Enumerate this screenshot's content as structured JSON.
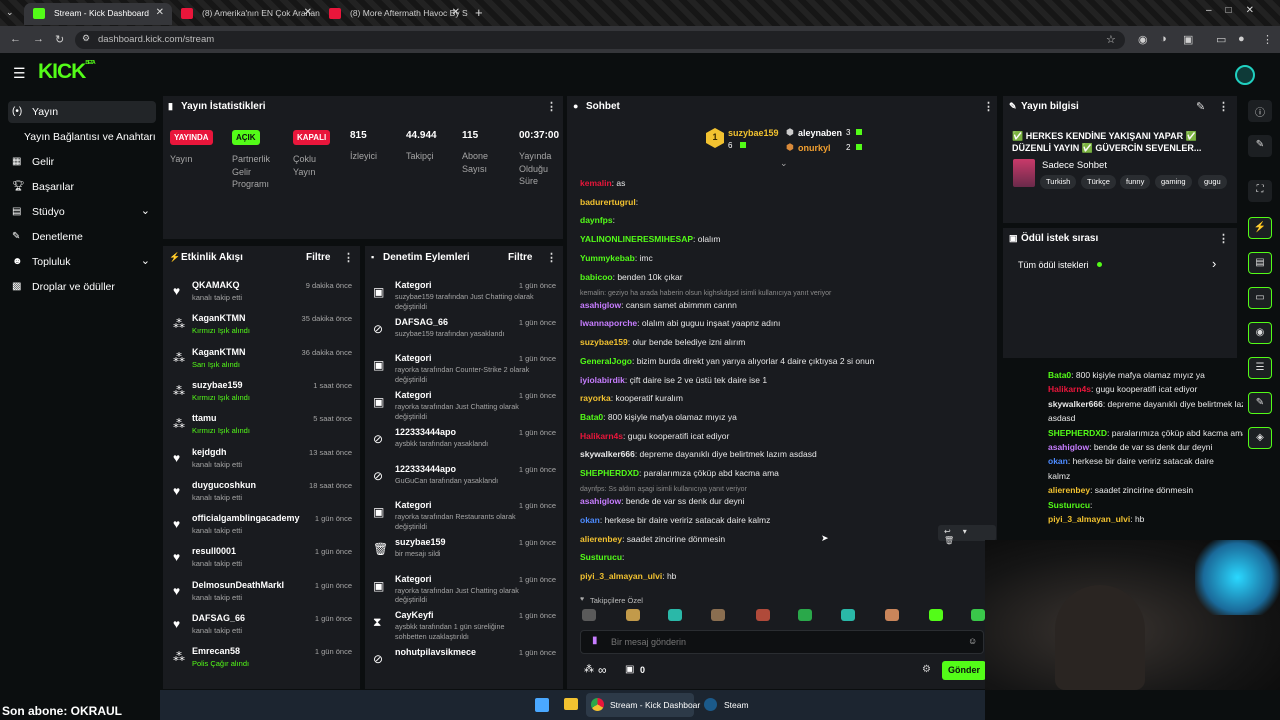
{
  "browser": {
    "tabs": [
      {
        "label": "Stream - Kick Dashboard",
        "active": true
      },
      {
        "label": "(8) Amerika'nın EN Çok Aranan...",
        "active": false
      },
      {
        "label": "(8) More Aftermath Havoc By S...",
        "active": false
      }
    ],
    "url": "dashboard.kick.com/stream"
  },
  "brand": {
    "logo": "KICK",
    "logo_sup": "BETA",
    "accent": "#53fc18"
  },
  "nav": {
    "items": [
      {
        "label": "Yayın",
        "icon": "broadcast-icon",
        "active": true
      },
      {
        "label": "Yayın Bağlantısı ve Anahtarı",
        "icon": "",
        "active": false
      },
      {
        "label": "Gelir",
        "icon": "revenue-icon",
        "active": false
      },
      {
        "label": "Başarılar",
        "icon": "trophy-icon",
        "active": false
      },
      {
        "label": "Stüdyo",
        "icon": "studio-icon",
        "active": false,
        "chevron": true
      },
      {
        "label": "Denetleme",
        "icon": "wrench-icon",
        "active": false
      },
      {
        "label": "Topluluk",
        "icon": "community-icon",
        "active": false,
        "chevron": true
      },
      {
        "label": "Droplar ve ödüller",
        "icon": "gift-icon",
        "active": false
      }
    ]
  },
  "stats": {
    "title": "Yayın İstatistikleri",
    "badges": [
      {
        "badge": "YAYINDA",
        "label": "Yayın",
        "color": "#e9163b"
      },
      {
        "badge": "AÇIK",
        "label": "Partnerlik Gelir Programı",
        "color": "#53fc18"
      },
      {
        "badge": "KAPALI",
        "label": "Çoklu Yayın",
        "color": "#e9163b"
      }
    ],
    "numbers": [
      {
        "value": "815",
        "label": "İzleyici"
      },
      {
        "value": "44.944",
        "label": "Takipçi"
      },
      {
        "value": "115",
        "label": "Abone Sayısı"
      },
      {
        "value": "00:37:00",
        "label": "Yayında Olduğu Süre"
      }
    ]
  },
  "activity": {
    "title": "Etkinlik Akışı",
    "filter": "Filtre",
    "items": [
      {
        "name": "QKAMAKQ",
        "sub": "kanalı takip etti",
        "time": "9 dakika önce",
        "icon": "heart-icon"
      },
      {
        "name": "KaganKTMN",
        "sub": "Kırmızı Işık alındı",
        "time": "35 dakika önce",
        "icon": "reward-icon"
      },
      {
        "name": "KaganKTMN",
        "sub": "Sarı Işık alındı",
        "time": "36 dakika önce",
        "icon": "reward-icon"
      },
      {
        "name": "suzybae159",
        "sub": "Kırmızı Işık alındı",
        "time": "1 saat önce",
        "icon": "reward-icon"
      },
      {
        "name": "ttamu",
        "sub": "Kırmızı Işık alındı",
        "time": "5 saat önce",
        "icon": "reward-icon"
      },
      {
        "name": "kejdgdh",
        "sub": "kanalı takip etti",
        "time": "13 saat önce",
        "icon": "heart-icon"
      },
      {
        "name": "duygucoshkun",
        "sub": "kanalı takip etti",
        "time": "18 saat önce",
        "icon": "heart-icon"
      },
      {
        "name": "officialgamblingacademy",
        "sub": "kanalı takip etti",
        "time": "1 gün önce",
        "icon": "heart-icon"
      },
      {
        "name": "resull0001",
        "sub": "kanalı takip etti",
        "time": "1 gün önce",
        "icon": "heart-icon"
      },
      {
        "name": "DelmosunDeathMarkI",
        "sub": "kanalı takip etti",
        "time": "1 gün önce",
        "icon": "heart-icon"
      },
      {
        "name": "DAFSAG_66",
        "sub": "kanalı takip etti",
        "time": "1 gün önce",
        "icon": "heart-icon"
      },
      {
        "name": "Emrecan58",
        "sub": "Polis Çağır alındı",
        "time": "1 gün önce",
        "icon": "reward-icon"
      }
    ]
  },
  "moderation": {
    "title": "Denetim Eylemleri",
    "filter": "Filtre",
    "items": [
      {
        "name": "Kategori",
        "sub": "suzybae159 tarafından Just Chatting olarak değiştirildi",
        "time": "1 gün önce",
        "icon": "category-icon"
      },
      {
        "name": "DAFSAG_66",
        "sub": "suzybae159 tarafından yasaklandı",
        "time": "1 gün önce",
        "icon": "ban-icon"
      },
      {
        "name": "Kategori",
        "sub": "rayorka tarafından Counter-Strike 2 olarak değiştirildi",
        "time": "1 gün önce",
        "icon": "category-icon"
      },
      {
        "name": "Kategori",
        "sub": "rayorka tarafından Just Chatting olarak değiştirildi",
        "time": "1 gün önce",
        "icon": "category-icon"
      },
      {
        "name": "122333444apo",
        "sub": "aysbkk tarafından yasaklandı",
        "time": "1 gün önce",
        "icon": "ban-icon"
      },
      {
        "name": "122333444apo",
        "sub": "GuGuCan tarafından yasaklandı",
        "time": "1 gün önce",
        "icon": "ban-icon"
      },
      {
        "name": "Kategori",
        "sub": "rayorka tarafından Restaurants olarak değiştirildi",
        "time": "1 gün önce",
        "icon": "category-icon"
      },
      {
        "name": "suzybae159",
        "sub": "bir mesajı sildi",
        "time": "1 gün önce",
        "icon": "trash-icon"
      },
      {
        "name": "Kategori",
        "sub": "rayorka tarafından Just Chatting olarak değiştirildi",
        "time": "1 gün önce",
        "icon": "category-icon"
      },
      {
        "name": "CayKeyfi",
        "sub": "aysbkk tarafından 1 gün süreliğine sohbetten uzaklaştırıldı",
        "time": "1 gün önce",
        "icon": "timeout-icon"
      },
      {
        "name": "nohutpilavsikmece",
        "sub": "",
        "time": "1 gün önce",
        "icon": "ban-icon"
      }
    ]
  },
  "chat": {
    "title": "Sohbet",
    "leaders": [
      {
        "name": "suzybae159",
        "count": "6"
      },
      {
        "name": "aleynaben",
        "count": "3"
      },
      {
        "name": "onurkyl",
        "count": "2"
      }
    ],
    "messages": [
      {
        "user": "kemalin",
        "color": "#e9163b",
        "text": ": as"
      },
      {
        "user": "badurertugrul",
        "color": "#f2c230",
        "text": ":"
      },
      {
        "user": "daynfps",
        "color": "#53fc18",
        "text": ":"
      },
      {
        "user": "YALINONLINERESMIHESAP",
        "color": "#53fc18",
        "text": ": olalım"
      },
      {
        "user": "Yummykebab",
        "color": "#53fc18",
        "text": ": imc"
      },
      {
        "user": "babicoo",
        "color": "#53fc18",
        "text": ": benden 10k çıkar"
      },
      {
        "reply": "kemalin: geziyo ha arada haberin olsun kighskdgsd isimli kullanıcıya yanıt veriyor"
      },
      {
        "user": "asahiglow",
        "color": "#c77dff",
        "text": ": cansın samet abimmm cannn"
      },
      {
        "user": "lwannaporche",
        "color": "#c77dff",
        "text": ": olalım abi guguu inşaat yaapnz adını"
      },
      {
        "user": "suzybae159",
        "color": "#f2c230",
        "text": ": olur bende belediye izni alırım"
      },
      {
        "user": "GeneralJogo",
        "color": "#53fc18",
        "text": ": bizim burda direkt yan yarıya alıyorlar 4 daire çıktıysa 2 si onun"
      },
      {
        "user": "iyiolabirdik",
        "color": "#c77dff",
        "text": ": çift daire ise 2 ve üstü tek daire ise 1"
      },
      {
        "user": "rayorka",
        "color": "#f2c230",
        "text": ": kooperatif kuralım"
      },
      {
        "user": "Bata0",
        "color": "#53fc18",
        "text": ": 800 kişiyle mafya olamaz mıyız ya"
      },
      {
        "user": "Halikarn4s",
        "color": "#e9163b",
        "text": ": gugu kooperatifi icat ediyor"
      },
      {
        "user": "skywalker666",
        "color": "#e8e8e8",
        "text": ": depreme dayanıklı diye belirtmek lazım asdasd"
      },
      {
        "user": "SHEPHERDXD",
        "color": "#53fc18",
        "text": ": paralarımıza çöküp abd kacma ama"
      },
      {
        "reply": "daynfps: Ss aldım aşagi isimli kullanıcıya yanıt veriyor"
      },
      {
        "user": "asahiglow",
        "color": "#c77dff",
        "text": ": bende de var ss denk dur deyni"
      },
      {
        "user": "okan",
        "color": "#4d8bff",
        "text": ": herkese bir daire veririz satacak daire kalmz"
      },
      {
        "user": "alierenbey",
        "color": "#f2c230",
        "text": ": saadet zincirine dönmesin"
      },
      {
        "user": "Susturucu",
        "color": "#53fc18",
        "text": ":"
      },
      {
        "user": "piyi_3_almayan_ulvi",
        "color": "#f2c230",
        "text": ": hb"
      }
    ],
    "followers_only": "Takipçilere Özel",
    "input_placeholder": "Bir mesaj gönderin",
    "infinity": "∞",
    "zero": "0",
    "send": "Gönder"
  },
  "stream_info": {
    "title": "Yayın bilgisi",
    "stream_title": "✅ HERKES KENDİNE YAKIŞANI YAPAR ✅ DÜZENLİ YAYIN ✅ GÜVERCİN SEVENLER...",
    "category": "Sadece Sohbet",
    "tags": [
      "Turkish",
      "Türkçe",
      "funny",
      "gaming",
      "gugu"
    ]
  },
  "rewards": {
    "title": "Ödül istek sırası",
    "all": "Tüm ödül istekleri"
  },
  "side_chat": [
    {
      "user": "Bata0",
      "color": "#53fc18",
      "text": ": 800 kişiyle mafya olamaz mıyız ya"
    },
    {
      "user": "Halikarn4s",
      "color": "#e9163b",
      "text": ": gugu kooperatifi icat ediyor"
    },
    {
      "user": "skywalker666",
      "color": "#e8e8e8",
      "text": ": depreme dayanıklı diye belirtmek lazım"
    },
    {
      "user": "",
      "color": "#e8e8e8",
      "text": "asdasd"
    },
    {
      "user": "SHEPHERDXD",
      "color": "#53fc18",
      "text": ": paralarımıza çöküp abd kacma ama"
    },
    {
      "user": "asahiglow",
      "color": "#c77dff",
      "text": ": bende de var ss denk dur deyni"
    },
    {
      "user": "okan",
      "color": "#4d8bff",
      "text": ": herkese bir daire veririz satacak daire"
    },
    {
      "user": "",
      "color": "#e8e8e8",
      "text": "kalmz"
    },
    {
      "user": "alierenbey",
      "color": "#f2c230",
      "text": ": saadet zincirine dönmesin"
    },
    {
      "user": "Susturucu",
      "color": "#53fc18",
      "text": ":"
    },
    {
      "user": "piyi_3_almayan_ulvi",
      "color": "#f2c230",
      "text": ": hb"
    }
  ],
  "overlay": {
    "last_sub": "Son abone: OKRAUL"
  },
  "taskbar": {
    "items": [
      {
        "label": "Stream - Kick Dashboar"
      },
      {
        "label": "Steam"
      }
    ]
  }
}
